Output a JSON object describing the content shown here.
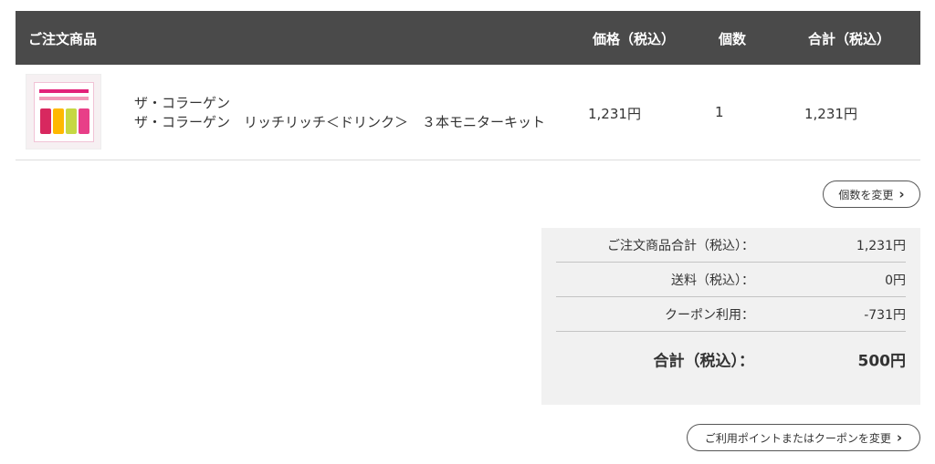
{
  "table": {
    "headers": {
      "product": "ご注文商品",
      "price": "価格（税込）",
      "quantity": "個数",
      "total": "合計（税込）"
    },
    "items": [
      {
        "brand": "ザ・コラーゲン",
        "name": "ザ・コラーゲン　リッチリッチ＜ドリンク＞　３本モニターキット",
        "price": "1,231円",
        "quantity": "1",
        "total": "1,231円"
      }
    ]
  },
  "buttons": {
    "change_quantity": "個数を変更",
    "change_points": "ご利用ポイントまたはクーポンを変更"
  },
  "summary": {
    "subtotal_label": "ご注文商品合計（税込）：",
    "subtotal_value": "1,231円",
    "shipping_label": "送料（税込）：",
    "shipping_value": "0円",
    "coupon_label": "クーポン利用：",
    "coupon_value": "-731円",
    "total_label": "合計（税込）：",
    "total_value": "500円"
  },
  "colors": {
    "header_background": "#4a4a4a",
    "summary_background": "#f1f1f1",
    "accent_pink": "#e2227a"
  },
  "icons": {
    "chevron": "chevron-right-icon"
  }
}
